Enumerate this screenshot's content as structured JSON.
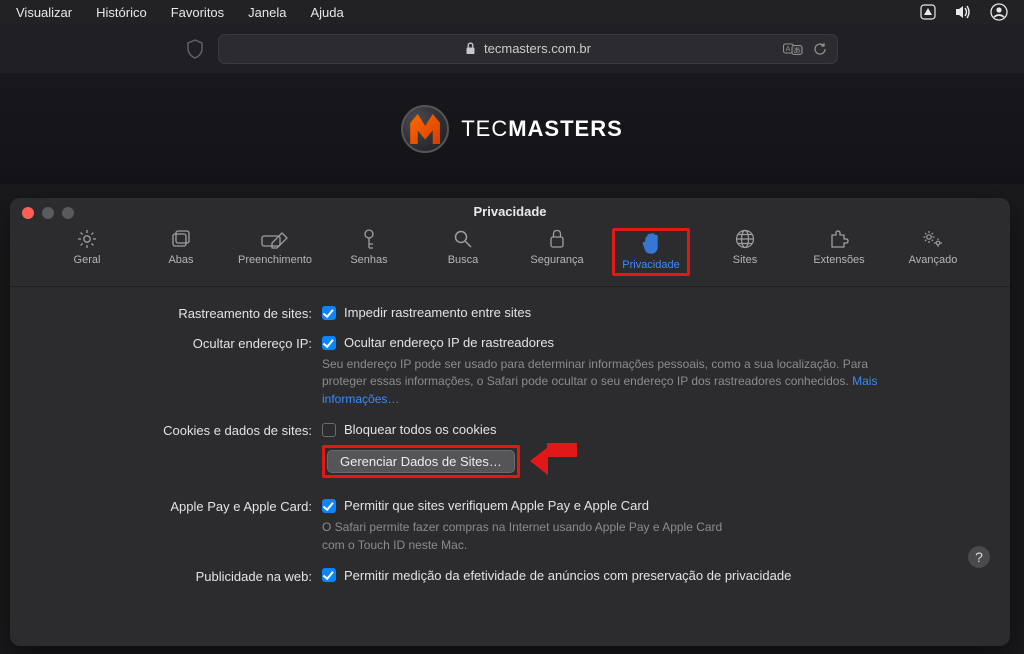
{
  "menubar": {
    "items": [
      "Visualizar",
      "Histórico",
      "Favoritos",
      "Janela",
      "Ajuda"
    ]
  },
  "urlbar": {
    "domain": "tecmasters.com.br"
  },
  "page_header": {
    "brand_light": "TEC",
    "brand_bold": "MASTERS"
  },
  "prefs": {
    "title": "Privacidade",
    "tabs": [
      {
        "label": "Geral"
      },
      {
        "label": "Abas"
      },
      {
        "label": "Preenchimento"
      },
      {
        "label": "Senhas"
      },
      {
        "label": "Busca"
      },
      {
        "label": "Segurança"
      },
      {
        "label": "Privacidade"
      },
      {
        "label": "Sites"
      },
      {
        "label": "Extensões"
      },
      {
        "label": "Avançado"
      }
    ],
    "rows": {
      "tracking": {
        "label": "Rastreamento de sites:",
        "checkbox_label": "Impedir rastreamento entre sites"
      },
      "hide_ip": {
        "label": "Ocultar endereço IP:",
        "checkbox_label": "Ocultar endereço IP de rastreadores",
        "desc": "Seu endereço IP pode ser usado para determinar informações pessoais, como a sua localização. Para proteger essas informações, o Safari pode ocultar o seu endereço IP dos rastreadores conhecidos.",
        "link": "Mais informações…"
      },
      "cookies": {
        "label": "Cookies e dados de sites:",
        "checkbox_label": "Bloquear todos os cookies",
        "button": "Gerenciar Dados de Sites…"
      },
      "applepay": {
        "label": "Apple Pay e Apple Card:",
        "checkbox_label": "Permitir que sites verifiquem Apple Pay e Apple Card",
        "desc": "O Safari permite fazer compras na Internet usando Apple Pay e Apple Card com o Touch ID neste Mac."
      },
      "ads": {
        "label": "Publicidade na web:",
        "checkbox_label": "Permitir medição da efetividade de anúncios com preservação de privacidade"
      }
    },
    "help": "?"
  }
}
